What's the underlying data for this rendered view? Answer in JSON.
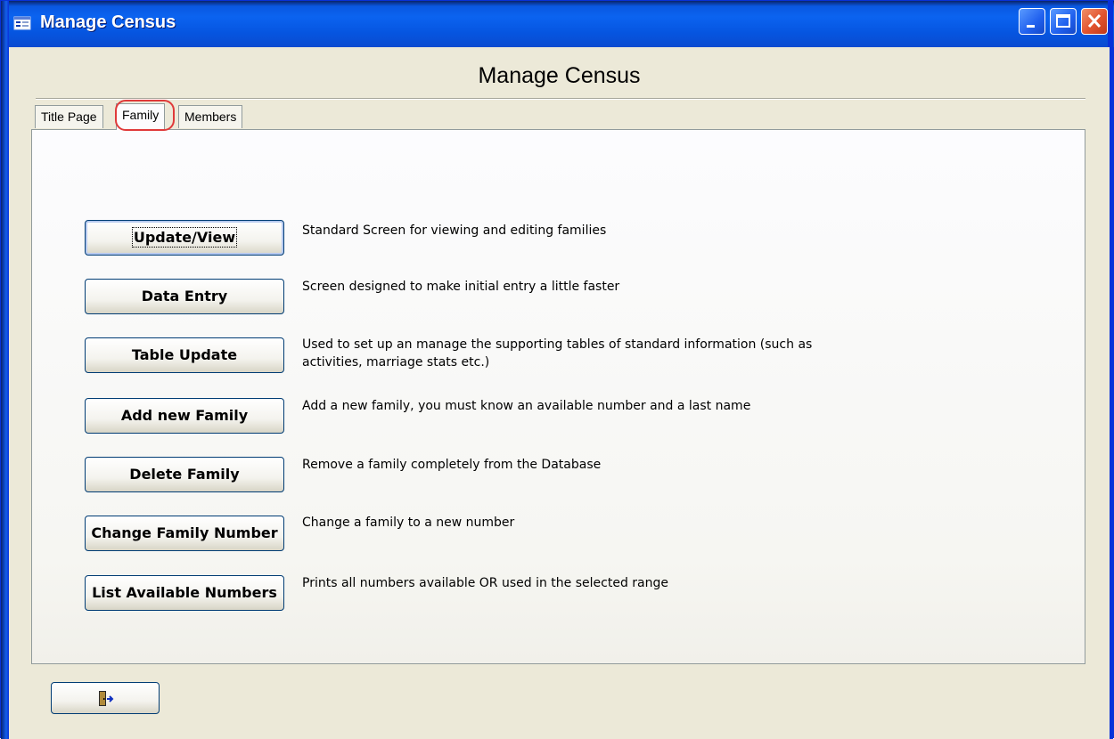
{
  "window": {
    "title": "Manage Census",
    "controls": {
      "minimize": "minimize-icon",
      "maximize": "maximize-icon",
      "close": "close-icon"
    }
  },
  "form": {
    "heading": "Manage Census"
  },
  "tabs": [
    {
      "label": "Title Page",
      "active": false
    },
    {
      "label": "Family",
      "active": true
    },
    {
      "label": "Members",
      "active": false
    }
  ],
  "actions": [
    {
      "label": "Update/View",
      "description": "Standard Screen for viewing and editing families"
    },
    {
      "label": "Data Entry",
      "description": "Screen designed to make initial entry a little faster"
    },
    {
      "label": "Table Update",
      "description": "Used to set up an manage the supporting tables of standard information (such as\nactivities, marriage stats etc.)"
    },
    {
      "label": "Add new Family",
      "description": "Add a new family, you must know an available number and a last name"
    },
    {
      "label": "Delete Family",
      "description": "Remove a family completely from the Database"
    },
    {
      "label": "Change Family Number",
      "description": "Change a family to a new number"
    },
    {
      "label": "List Available Numbers",
      "description": "Prints all numbers available OR used in the selected range"
    }
  ],
  "footer": {
    "exit_icon": "exit-door-icon"
  },
  "colors": {
    "titlebar": "#0a58e0",
    "highlight": "#e03a3a",
    "button_border": "#003c74"
  }
}
